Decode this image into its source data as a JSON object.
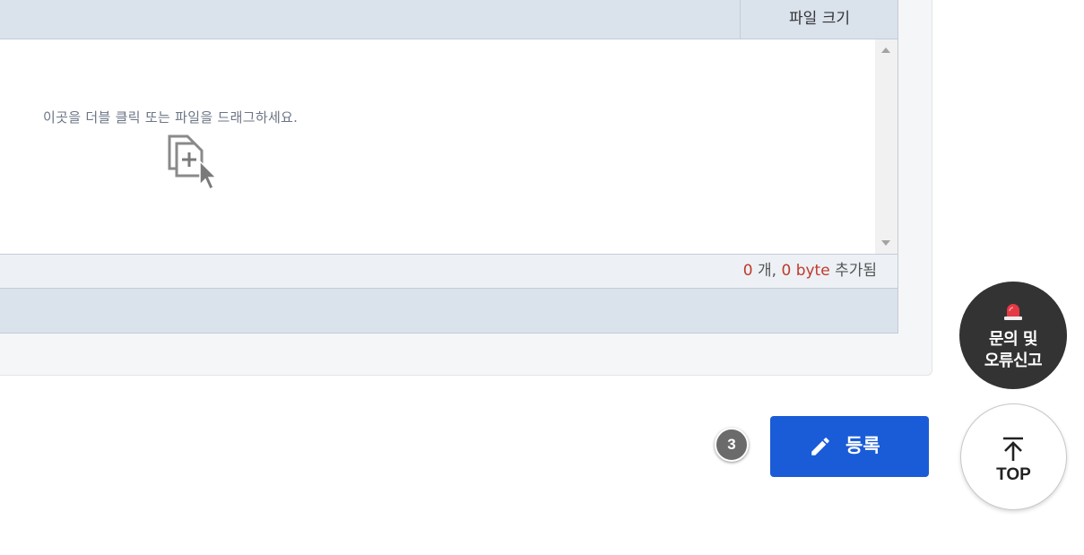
{
  "uploader": {
    "header": {
      "size_column": "파일 크기"
    },
    "dropzone": {
      "hint": "이곳을 더블 클릭 또는 파일을 드래그하세요."
    },
    "status": {
      "count": "0",
      "count_unit": " 개, ",
      "bytes": "0 byte",
      "suffix": " 추가됨"
    }
  },
  "step_badge": "3",
  "submit": {
    "label": "등록"
  },
  "report": {
    "line1": "문의 및",
    "line2": "오류신고"
  },
  "top": {
    "label": "TOP"
  },
  "colors": {
    "accent": "#1a5cd7",
    "count_red": "#c0392b",
    "fab_dark": "#333333"
  },
  "icons": {
    "dropzone": "file-add-icon",
    "submit": "pencil-icon",
    "report": "siren-icon",
    "top": "arrow-up-icon"
  }
}
